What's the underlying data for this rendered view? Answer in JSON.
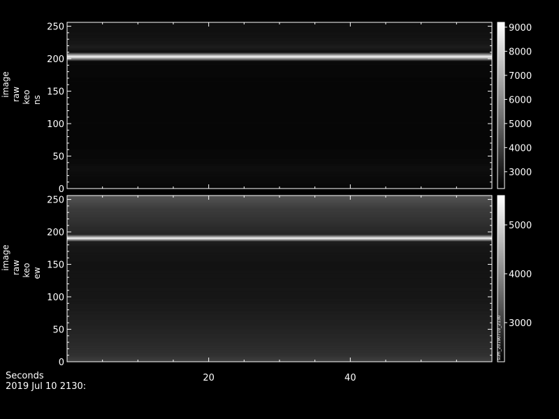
{
  "chart_data": [
    {
      "type": "heatmap",
      "ylabel": [
        "image",
        "raw",
        "keo",
        "ns"
      ],
      "y_ticks": [
        0,
        50,
        100,
        150,
        200,
        250
      ],
      "ylim": [
        0,
        256
      ],
      "x_ticks": [
        20,
        40
      ],
      "xlim": [
        0,
        60
      ],
      "colorbar": {
        "ticks": [
          3000,
          4000,
          5000,
          6000,
          7000,
          8000,
          9000
        ],
        "range": [
          2300,
          9200
        ]
      },
      "bright_line_y": 203,
      "row_profile": [
        {
          "y": 0,
          "v": 2450
        },
        {
          "y": 6,
          "v": 2550
        },
        {
          "y": 20,
          "v": 2620
        },
        {
          "y": 32,
          "v": 2700
        },
        {
          "y": 40,
          "v": 2580
        },
        {
          "y": 60,
          "v": 2500
        },
        {
          "y": 150,
          "v": 2480
        },
        {
          "y": 185,
          "v": 2520
        },
        {
          "y": 196,
          "v": 2600
        },
        {
          "y": 203,
          "v": 9000
        },
        {
          "y": 210,
          "v": 2750
        },
        {
          "y": 218,
          "v": 3100
        },
        {
          "y": 224,
          "v": 2900
        },
        {
          "y": 235,
          "v": 2800
        },
        {
          "y": 245,
          "v": 2750
        },
        {
          "y": 256,
          "v": 2700
        }
      ]
    },
    {
      "type": "heatmap",
      "ylabel": [
        "image",
        "raw",
        "keo",
        "ew"
      ],
      "y_ticks": [
        0,
        50,
        100,
        150,
        200,
        250
      ],
      "ylim": [
        0,
        256
      ],
      "x_ticks": [
        20,
        40
      ],
      "xlim": [
        0,
        60
      ],
      "colorbar": {
        "ticks": [
          3000,
          4000,
          5000
        ],
        "range": [
          2200,
          5600
        ]
      },
      "bright_line_y": 190,
      "row_profile": [
        {
          "y": 0,
          "v": 3050
        },
        {
          "y": 10,
          "v": 2850
        },
        {
          "y": 30,
          "v": 2750
        },
        {
          "y": 55,
          "v": 2650
        },
        {
          "y": 100,
          "v": 2500
        },
        {
          "y": 150,
          "v": 2450
        },
        {
          "y": 175,
          "v": 2500
        },
        {
          "y": 185,
          "v": 2600
        },
        {
          "y": 190,
          "v": 5400
        },
        {
          "y": 196,
          "v": 2700
        },
        {
          "y": 215,
          "v": 2850
        },
        {
          "y": 235,
          "v": 3000
        },
        {
          "y": 248,
          "v": 3200
        },
        {
          "y": 256,
          "v": 3300
        }
      ],
      "side_annotation": "sum_20190710_2130"
    }
  ],
  "footer": {
    "xaxis_label": "Seconds",
    "timestamp": "2019 Jul 10 2130:"
  }
}
